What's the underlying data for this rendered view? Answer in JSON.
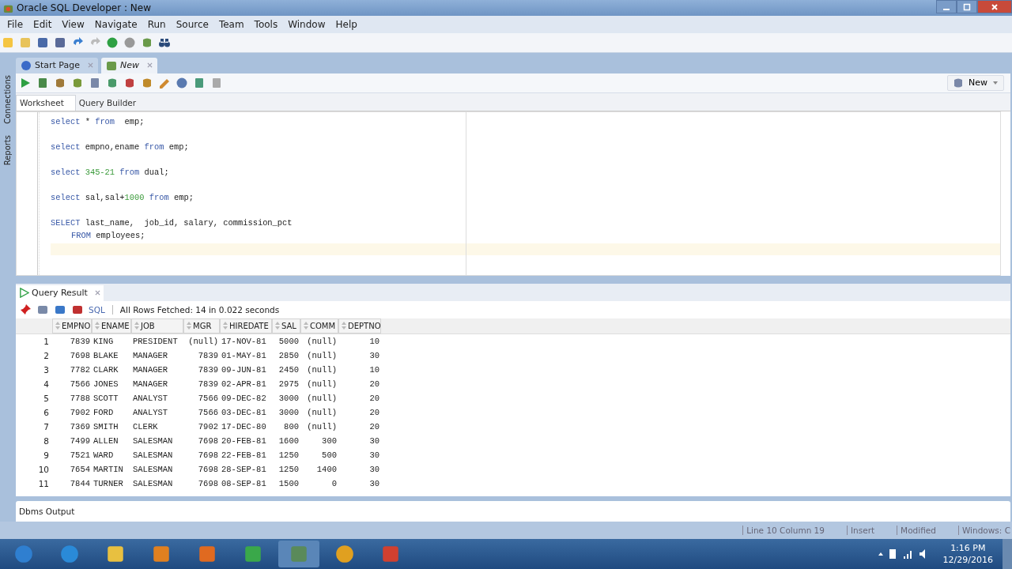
{
  "window": {
    "title": "Oracle SQL Developer : New"
  },
  "menu": [
    "File",
    "Edit",
    "View",
    "Navigate",
    "Run",
    "Source",
    "Team",
    "Tools",
    "Window",
    "Help"
  ],
  "side_tabs": [
    "Connections",
    "Reports"
  ],
  "doc_tabs": [
    {
      "label": "Start Page",
      "selected": false
    },
    {
      "label": "New",
      "selected": true
    }
  ],
  "connection_button": {
    "label": "New"
  },
  "editor_tabs": [
    {
      "label": "Worksheet",
      "selected": true
    },
    {
      "label": "Query Builder",
      "selected": false
    }
  ],
  "statements": [
    {
      "lines": [
        {
          "indent": false,
          "tokens": [
            {
              "kind": "keyword",
              "text": "select"
            },
            {
              "kind": "text",
              "text": " * "
            },
            {
              "kind": "keyword",
              "text": "from"
            },
            {
              "kind": "text",
              "text": "  emp;"
            }
          ]
        }
      ]
    },
    {
      "lines": [
        {
          "indent": false,
          "tokens": [
            {
              "kind": "keyword",
              "text": "select"
            },
            {
              "kind": "text",
              "text": " empno,ename "
            },
            {
              "kind": "keyword",
              "text": "from"
            },
            {
              "kind": "text",
              "text": " emp;"
            }
          ]
        }
      ]
    },
    {
      "lines": [
        {
          "indent": false,
          "tokens": [
            {
              "kind": "keyword",
              "text": "select"
            },
            {
              "kind": "number",
              "text": " 345-21 "
            },
            {
              "kind": "keyword",
              "text": "from"
            },
            {
              "kind": "text",
              "text": " dual;"
            }
          ]
        }
      ]
    },
    {
      "lines": [
        {
          "indent": false,
          "tokens": [
            {
              "kind": "keyword",
              "text": "select"
            },
            {
              "kind": "text",
              "text": " sal,sal+"
            },
            {
              "kind": "number",
              "text": "1000 "
            },
            {
              "kind": "keyword",
              "text": "from"
            },
            {
              "kind": "text",
              "text": " emp;"
            }
          ]
        }
      ]
    },
    {
      "lines": [
        {
          "indent": false,
          "tokens": [
            {
              "kind": "keyword",
              "text": "SELECT"
            },
            {
              "kind": "text",
              "text": " last_name,  job_id, salary, commission_pct"
            }
          ]
        },
        {
          "indent": true,
          "tokens": [
            {
              "kind": "keyword",
              "text": "FROM"
            },
            {
              "kind": "text",
              "text": " employees;"
            }
          ]
        }
      ]
    }
  ],
  "result_tab": {
    "label": "Query Result"
  },
  "result_toolbar": {
    "sql_label": "SQL",
    "message": "All Rows Fetched: 14 in 0.022 seconds"
  },
  "table": {
    "columns": [
      {
        "label": "EMPNO"
      },
      {
        "label": "ENAME"
      },
      {
        "label": "JOB"
      },
      {
        "label": "MGR"
      },
      {
        "label": "HIREDATE"
      },
      {
        "label": "SAL"
      },
      {
        "label": "COMM"
      },
      {
        "label": "DEPTNO"
      }
    ],
    "rows": [
      {
        "num": "1",
        "cells": [
          "7839",
          "KING",
          "PRESIDENT",
          "(null)",
          "17-NOV-81",
          "5000",
          "(null)",
          "10"
        ]
      },
      {
        "num": "2",
        "cells": [
          "7698",
          "BLAKE",
          "MANAGER",
          "7839",
          "01-MAY-81",
          "2850",
          "(null)",
          "30"
        ]
      },
      {
        "num": "3",
        "cells": [
          "7782",
          "CLARK",
          "MANAGER",
          "7839",
          "09-JUN-81",
          "2450",
          "(null)",
          "10"
        ]
      },
      {
        "num": "4",
        "cells": [
          "7566",
          "JONES",
          "MANAGER",
          "7839",
          "02-APR-81",
          "2975",
          "(null)",
          "20"
        ]
      },
      {
        "num": "5",
        "cells": [
          "7788",
          "SCOTT",
          "ANALYST",
          "7566",
          "09-DEC-82",
          "3000",
          "(null)",
          "20"
        ]
      },
      {
        "num": "6",
        "cells": [
          "7902",
          "FORD",
          "ANALYST",
          "7566",
          "03-DEC-81",
          "3000",
          "(null)",
          "20"
        ]
      },
      {
        "num": "7",
        "cells": [
          "7369",
          "SMITH",
          "CLERK",
          "7902",
          "17-DEC-80",
          "800",
          "(null)",
          "20"
        ]
      },
      {
        "num": "8",
        "cells": [
          "7499",
          "ALLEN",
          "SALESMAN",
          "7698",
          "20-FEB-81",
          "1600",
          "300",
          "30"
        ]
      },
      {
        "num": "9",
        "cells": [
          "7521",
          "WARD",
          "SALESMAN",
          "7698",
          "22-FEB-81",
          "1250",
          "500",
          "30"
        ]
      },
      {
        "num": "10",
        "cells": [
          "7654",
          "MARTIN",
          "SALESMAN",
          "7698",
          "28-SEP-81",
          "1250",
          "1400",
          "30"
        ]
      },
      {
        "num": "11",
        "cells": [
          "7844",
          "TURNER",
          "SALESMAN",
          "7698",
          "08-SEP-81",
          "1500",
          "0",
          "30"
        ]
      }
    ]
  },
  "dbms_output": {
    "title": "Dbms Output"
  },
  "status_bar": [
    "Line 10 Column 19",
    "Insert",
    "Modified",
    "Windows: C"
  ],
  "taskbar": {
    "time": "1:16 PM",
    "date": "12/29/2016"
  }
}
